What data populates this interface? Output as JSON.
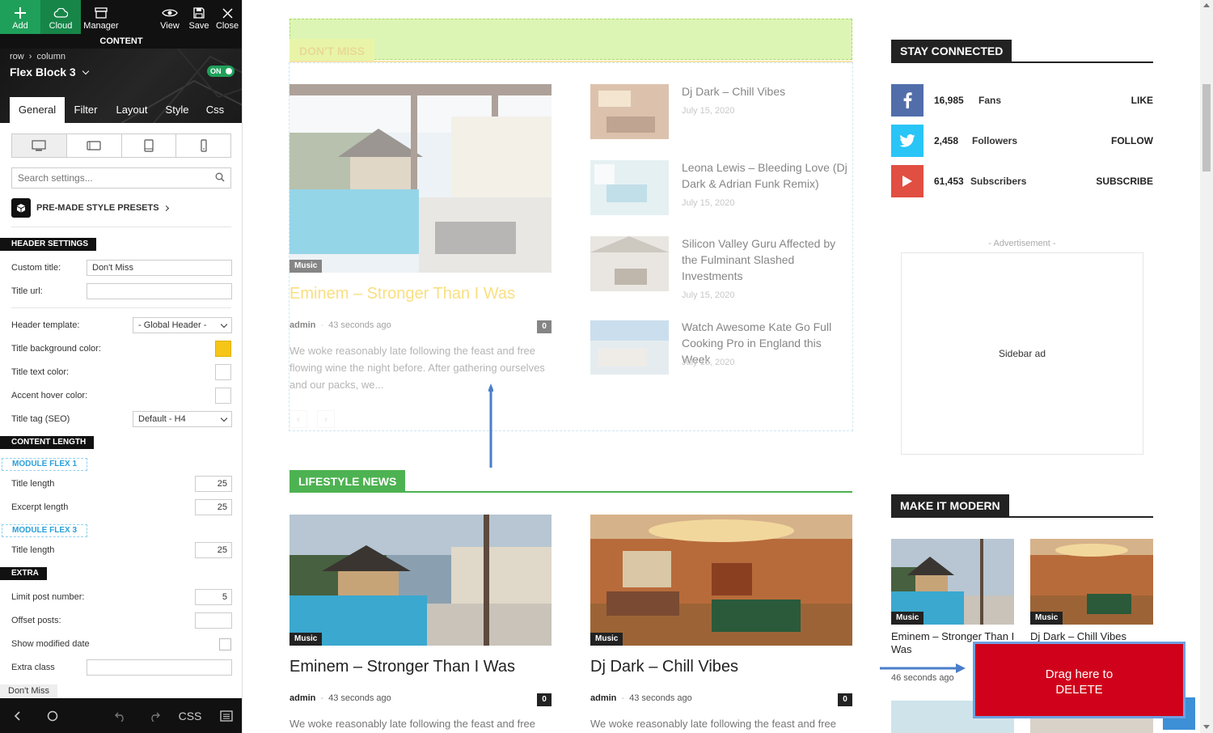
{
  "toolbar": {
    "add": "Add",
    "cloud": "Cloud",
    "manager": "Manager",
    "view": "View",
    "save": "Save",
    "close": "Close"
  },
  "content_bar": "CONTENT",
  "panel_header": {
    "breadcrumb_row": "row",
    "breadcrumb_sep": "›",
    "breadcrumb_column": "column",
    "title": "Flex Block 3",
    "toggle": "ON"
  },
  "tabs": [
    "General",
    "Filter",
    "Layout",
    "Style",
    "Css"
  ],
  "search": {
    "placeholder": "Search settings..."
  },
  "presets": "PRE-MADE STYLE PRESETS",
  "sections": {
    "header": "HEADER SETTINGS",
    "content_length": "CONTENT LENGTH",
    "module_flex1": "MODULE FLEX 1",
    "module_flex3": "MODULE FLEX 3",
    "extra": "EXTRA"
  },
  "fields": {
    "custom_title": {
      "label": "Custom title:",
      "value": "Don't Miss"
    },
    "title_url": {
      "label": "Title url:",
      "value": ""
    },
    "header_template": {
      "label": "Header template:",
      "value": "- Global Header -"
    },
    "title_bg_color": {
      "label": "Title background color:",
      "value": "#f5c518"
    },
    "title_text_color": {
      "label": "Title text color:"
    },
    "accent_hover_color": {
      "label": "Accent hover color:"
    },
    "title_tag": {
      "label": "Title tag (SEO)",
      "value": "Default - H4"
    },
    "flex1_title_length": {
      "label": "Title length",
      "value": "25"
    },
    "flex1_excerpt_length": {
      "label": "Excerpt length",
      "value": "25"
    },
    "flex3_title_length": {
      "label": "Title length",
      "value": "25"
    },
    "limit_post": {
      "label": "Limit post number:",
      "value": "5"
    },
    "offset_posts": {
      "label": "Offset posts:",
      "value": ""
    },
    "show_modified": {
      "label": "Show modified date"
    },
    "extra_class": {
      "label": "Extra class",
      "value": ""
    }
  },
  "bottom_crumb": "Don't Miss",
  "bottom_bar": {
    "css": "CSS"
  },
  "dont_miss": {
    "tag": "DON'T MISS",
    "main": {
      "category": "Music",
      "title": "Eminem – Stronger Than I Was",
      "author": "admin",
      "sep": "-",
      "time": "43 seconds ago",
      "comments": "0",
      "excerpt": "We woke reasonably late following the feast and free flowing wine the night before. After gathering ourselves and our packs, we..."
    },
    "list": [
      {
        "title": "Dj Dark – Chill Vibes",
        "date": "July 15, 2020"
      },
      {
        "title": "Leona Lewis – Bleeding Love (Dj Dark & Adrian Funk Remix)",
        "date": "July 15, 2020"
      },
      {
        "title": "Silicon Valley Guru Affected by the Fulminant Slashed Investments",
        "date": "July 15, 2020"
      },
      {
        "title": "Watch Awesome Kate Go Full Cooking Pro in England this Week",
        "date": "July 15, 2020"
      }
    ]
  },
  "lifestyle": {
    "tag": "LIFESTYLE NEWS",
    "posts": [
      {
        "category": "Music",
        "title": "Eminem – Stronger Than I Was",
        "author": "admin",
        "sep": "-",
        "time": "43 seconds ago",
        "comments": "0",
        "excerpt": "We woke reasonably late following the feast and free"
      },
      {
        "category": "Music",
        "title": "Dj Dark – Chill Vibes",
        "author": "admin",
        "sep": "-",
        "time": "43 seconds ago",
        "comments": "0",
        "excerpt": "We woke reasonably late following the feast and free"
      }
    ]
  },
  "sidebar": {
    "stay_connected": "STAY CONNECTED",
    "social": [
      {
        "count": "16,985",
        "unit": "Fans",
        "action": "LIKE",
        "color": "#516eab",
        "icon": "facebook-icon"
      },
      {
        "count": "2,458",
        "unit": "Followers",
        "action": "FOLLOW",
        "color": "#29c5f6",
        "icon": "twitter-icon"
      },
      {
        "count": "61,453",
        "unit": "Subscribers",
        "action": "SUBSCRIBE",
        "color": "#e14e42",
        "icon": "youtube-icon"
      }
    ],
    "advertisement": "- Advertisement -",
    "ad": "Sidebar ad",
    "make_modern": "MAKE IT MODERN",
    "modern_posts": [
      {
        "category": "Music",
        "title": "Eminem – Stronger Than I Was",
        "time": "46 seconds ago"
      },
      {
        "category": "Music",
        "title": "Dj Dark – Chill Vibes"
      }
    ]
  },
  "delete_zone": {
    "line1": "Drag here to",
    "line2": "DELETE"
  }
}
